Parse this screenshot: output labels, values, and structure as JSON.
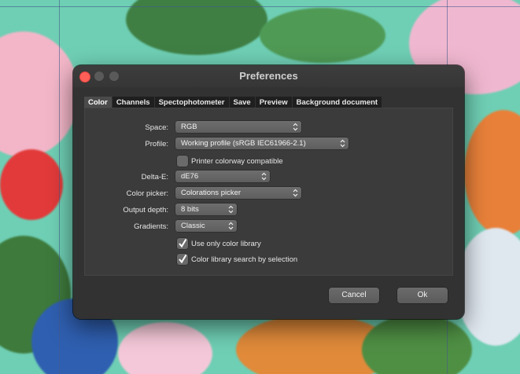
{
  "window": {
    "title": "Preferences"
  },
  "tabs": [
    {
      "label": "Color",
      "active": true
    },
    {
      "label": "Channels",
      "active": false
    },
    {
      "label": "Spectophotometer",
      "active": false
    },
    {
      "label": "Save",
      "active": false
    },
    {
      "label": "Preview",
      "active": false
    },
    {
      "label": "Background document",
      "active": false
    }
  ],
  "form": {
    "space": {
      "label": "Space:",
      "value": "RGB"
    },
    "profile": {
      "label": "Profile:",
      "value": "Working profile (sRGB IEC61966-2.1)"
    },
    "printer_colorway": {
      "label": "Printer colorway compatible",
      "checked": false
    },
    "delta_e": {
      "label": "Delta-E:",
      "value": "dE76"
    },
    "color_picker": {
      "label": "Color picker:",
      "value": "Colorations picker"
    },
    "output_depth": {
      "label": "Output depth:",
      "value": "8 bits"
    },
    "gradients": {
      "label": "Gradients:",
      "value": "Classic"
    },
    "use_only_color_library": {
      "label": "Use only color library",
      "checked": true
    },
    "color_library_search": {
      "label": "Color library search by selection",
      "checked": true
    }
  },
  "buttons": {
    "cancel": "Cancel",
    "ok": "Ok"
  },
  "colors": {
    "window_bg": "#323232",
    "panel_bg": "#3b3b3b",
    "close_red": "#ff5f57",
    "canvas_teal": "#6fcfb4"
  }
}
